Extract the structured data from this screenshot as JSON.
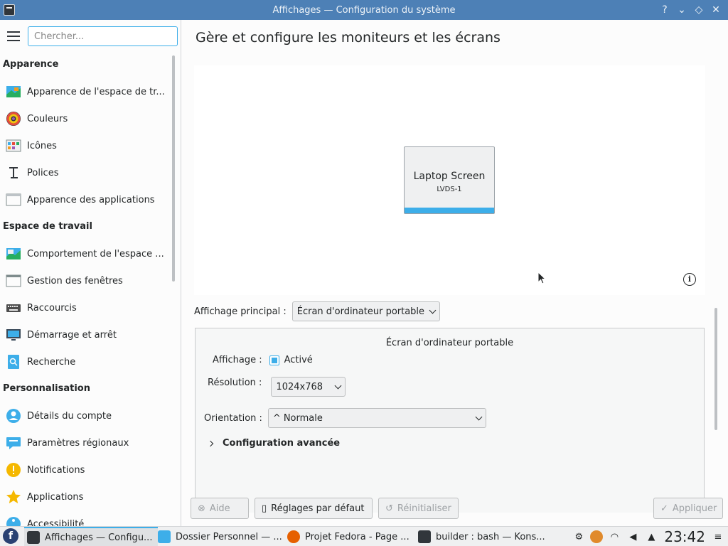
{
  "window": {
    "title": "Affichages — Configuration du système"
  },
  "sidebar": {
    "search_placeholder": "Chercher...",
    "categories": [
      {
        "label": "Apparence",
        "items": [
          {
            "label": "Apparence de l'espace de tr...",
            "icon": "workspace-theme-icon"
          },
          {
            "label": "Couleurs",
            "icon": "colors-icon"
          },
          {
            "label": "Icônes",
            "icon": "icons-icon"
          },
          {
            "label": "Polices",
            "icon": "fonts-icon"
          },
          {
            "label": "Apparence des applications",
            "icon": "app-style-icon"
          }
        ]
      },
      {
        "label": "Espace de travail",
        "items": [
          {
            "label": "Comportement de l'espace ...",
            "icon": "workspace-behavior-icon"
          },
          {
            "label": "Gestion des fenêtres",
            "icon": "window-management-icon"
          },
          {
            "label": "Raccourcis",
            "icon": "keyboard-icon"
          },
          {
            "label": "Démarrage et arrêt",
            "icon": "startup-icon"
          },
          {
            "label": "Recherche",
            "icon": "search-icon"
          }
        ]
      },
      {
        "label": "Personnalisation",
        "items": [
          {
            "label": "Détails du compte",
            "icon": "account-icon"
          },
          {
            "label": "Paramètres régionaux",
            "icon": "regional-icon"
          },
          {
            "label": "Notifications",
            "icon": "notifications-icon"
          },
          {
            "label": "Applications",
            "icon": "applications-icon"
          },
          {
            "label": "Accessibilité",
            "icon": "accessibility-icon"
          }
        ]
      }
    ]
  },
  "main": {
    "heading": "Gère et configure les moniteurs et les écrans",
    "monitor": {
      "name": "Laptop Screen",
      "id": "LVDS-1"
    },
    "primary_label": "Affichage principal :",
    "primary_value": "Écran d'ordinateur portable",
    "panel": {
      "title": "Écran d'ordinateur portable",
      "display_label": "Affichage :",
      "enabled_label": "Activé",
      "resolution_label": "Résolution :",
      "resolution_value": "1024x768",
      "orientation_label": "Orientation :",
      "orientation_value": "Normale",
      "advanced_label": "Configuration avancée"
    },
    "buttons": {
      "help": "Aide",
      "defaults": "Réglages par défaut",
      "reset": "Réinitialiser",
      "apply": "Appliquer"
    }
  },
  "taskbar": {
    "tasks": [
      {
        "label": "Affichages — Configu...",
        "active": true
      },
      {
        "label": "Dossier Personnel — ...",
        "active": false
      },
      {
        "label": "Projet Fedora - Page ...",
        "active": false
      },
      {
        "label": "builder : bash — Kons...",
        "active": false
      }
    ],
    "clock": "23:42"
  },
  "colors": {
    "accent": "#3daee9",
    "titlebar": "#4d80b6"
  }
}
